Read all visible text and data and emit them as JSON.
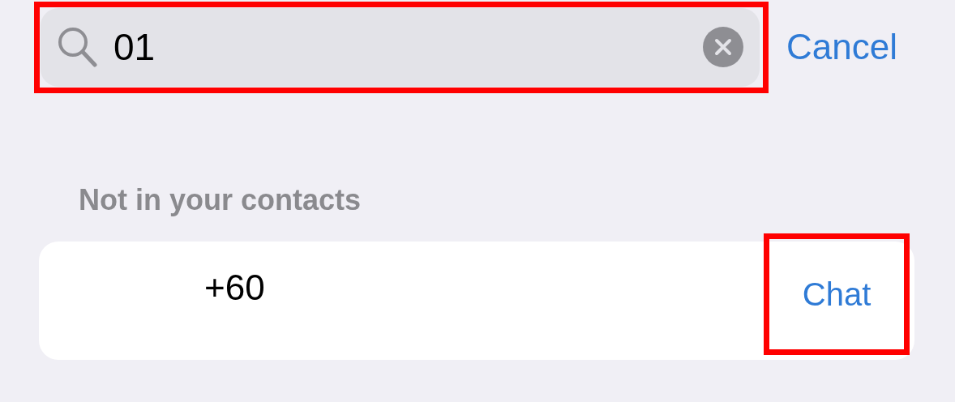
{
  "search": {
    "value": "01",
    "highlighted": true
  },
  "cancel_button": "Cancel",
  "section_header": "Not in your contacts",
  "contacts": [
    {
      "number": "+60",
      "action": "Chat",
      "action_highlighted": true
    }
  ]
}
